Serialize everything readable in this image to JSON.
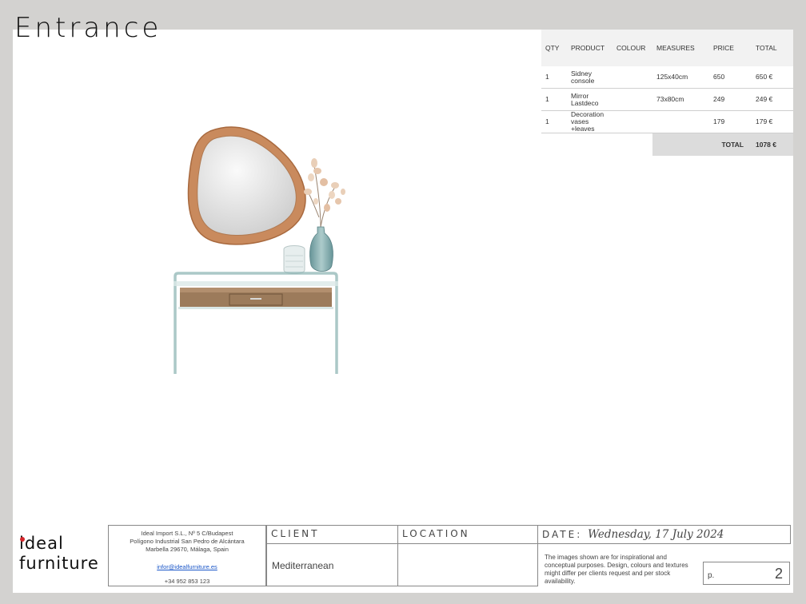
{
  "title": "Entrance",
  "table": {
    "headers": [
      "QTY",
      "PRODUCT",
      "COLOUR",
      "MEASURES",
      "PRICE",
      "TOTAL"
    ],
    "rows": [
      {
        "qty": "1",
        "product_line1": "Sidney",
        "product_line2": "console",
        "colour": "",
        "measures": "125x40cm",
        "price": "650",
        "total": "650 €"
      },
      {
        "qty": "1",
        "product_line1": "Mirror",
        "product_line2": "Lastdeco",
        "colour": "",
        "measures": "73x80cm",
        "price": "249",
        "total": "249 €"
      },
      {
        "qty": "1",
        "product_line1": "Decoration",
        "product_line2": "vases +leaves",
        "colour": "",
        "measures": "",
        "price": "179",
        "total": "179 €"
      }
    ],
    "total_label": "TOTAL",
    "total_value": "1078 €"
  },
  "logo": {
    "line1": "ideal",
    "line2": "furniture"
  },
  "company": {
    "line1": "Ideal Import S.L., Nº 5 C/Budapest",
    "line2": "Polígono Industrial San Pedro de Alcántara",
    "line3": "Marbella 29670, Málaga, Spain",
    "email": "infor@idealfurniture.es",
    "phone": "+34 952 853 123"
  },
  "footer": {
    "client_label": "CLIENT",
    "client_value": "Mediterranean",
    "location_label": "LOCATION",
    "location_value": "",
    "date_label": "DATE:",
    "date_value": "Wednesday, 17 July 2024",
    "disclaimer": "The images shown are for inspirational and conceptual purposes. Design, colours and textures might differ per clients request and per stock availability.",
    "page_label": "p.",
    "page_number": "2"
  },
  "colors": {
    "accent_dot": "#d4272c",
    "link": "#1a56c8",
    "wood": "#c98a5d",
    "glass": "#8fb6b4"
  }
}
